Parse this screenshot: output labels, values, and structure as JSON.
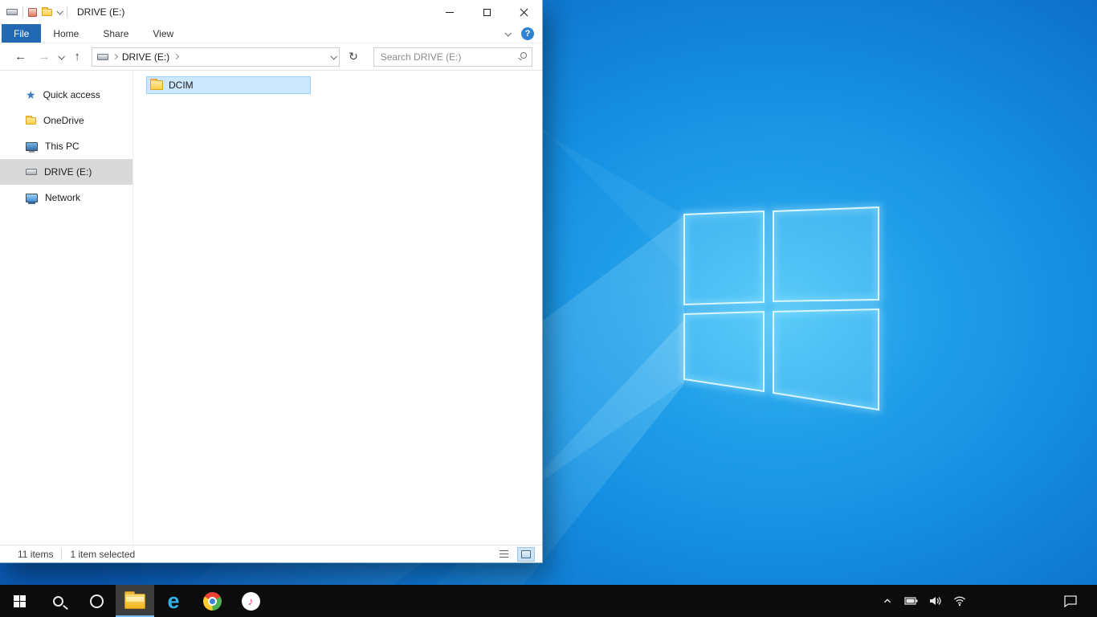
{
  "colors": {
    "accent_blue": "#2268b2",
    "selection_fill": "#cce8ff",
    "selection_border": "#99d1ff",
    "sidebar_selected": "#d9d9d9",
    "taskbar_bg": "#0c0c0c",
    "desktop_bright": "#2ba9ef",
    "desktop_dark": "#0a58b0",
    "folder_yellow": "#f2b31d"
  },
  "icons": {
    "back": "←",
    "forward": "→",
    "up": "↑",
    "refresh": "↻",
    "help": "?",
    "quick_access_star": "★",
    "ie_letter": "e",
    "music_note": "♪"
  },
  "explorer": {
    "title": "DRIVE (E:)",
    "ribbon": {
      "tabs": [
        {
          "label": "File",
          "active": true
        },
        {
          "label": "Home",
          "active": false
        },
        {
          "label": "Share",
          "active": false
        },
        {
          "label": "View",
          "active": false
        }
      ]
    },
    "nav": {
      "breadcrumb_root": "DRIVE (E:)",
      "search_placeholder": "Search DRIVE (E:)"
    },
    "sidebar": {
      "items": [
        {
          "label": "Quick access",
          "icon": "star-icon",
          "selected": false
        },
        {
          "label": "OneDrive",
          "icon": "onedrive-folder-icon",
          "selected": false
        },
        {
          "label": "This PC",
          "icon": "this-pc-icon",
          "selected": false
        },
        {
          "label": "DRIVE (E:)",
          "icon": "drive-icon",
          "selected": true
        },
        {
          "label": "Network",
          "icon": "network-icon",
          "selected": false
        }
      ]
    },
    "content": {
      "items": [
        {
          "label": "DCIM",
          "type": "folder",
          "selected": true
        }
      ]
    },
    "statusbar": {
      "item_count": "11 items",
      "selection": "1 item selected"
    }
  },
  "taskbar": {
    "buttons": [
      {
        "name": "start"
      },
      {
        "name": "search"
      },
      {
        "name": "cortana"
      },
      {
        "name": "file-explorer",
        "active": true
      },
      {
        "name": "internet-explorer"
      },
      {
        "name": "chrome"
      },
      {
        "name": "itunes"
      }
    ],
    "tray": [
      "show-hidden-icons",
      "battery",
      "volume",
      "network",
      "action-center"
    ]
  }
}
